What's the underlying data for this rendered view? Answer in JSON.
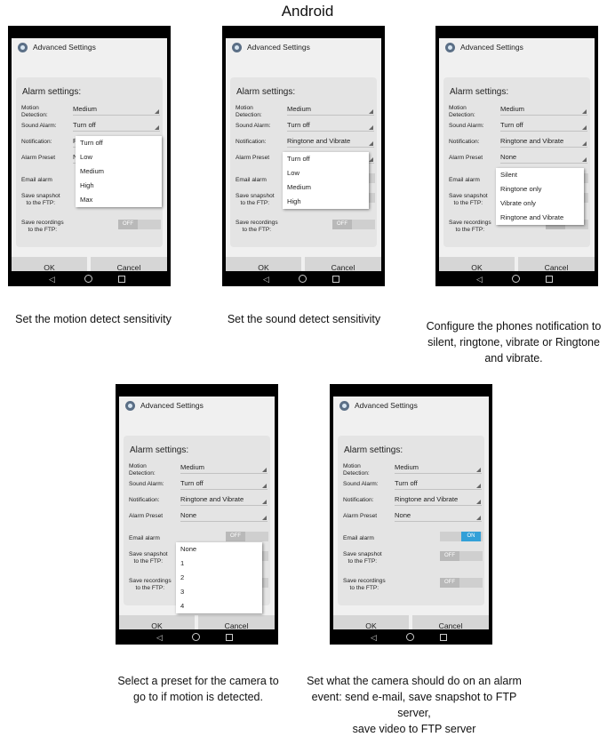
{
  "page_title": "Android",
  "screen": {
    "window_title": "Advanced Settings",
    "panel_title": "Alarm settings:",
    "labels": {
      "motion_line1": "Motion",
      "motion_line2": "Detection:",
      "sound": "Sound Alarm:",
      "notification": "Notification:",
      "preset": "Alarm Preset",
      "email": "Email alarm",
      "snapshot_line1": "Save snapshot",
      "snapshot_line2": "to the FTP:",
      "recordings_line1": "Save recordings",
      "recordings_line2": "to the FTP:"
    },
    "toggle_off_label": "OFF",
    "toggle_on_label": "ON",
    "ok_label": "OK",
    "cancel_label": "Cancel",
    "nav_back_glyph": "◁"
  },
  "phones": [
    {
      "values": {
        "motion": "Medium",
        "sound": "Turn off",
        "notification": "Ringtone and Vibrate",
        "preset": "None"
      },
      "dropdown": {
        "field": "motion",
        "options": [
          "Turn off",
          "Low",
          "Medium",
          "High",
          "Max"
        ]
      },
      "caption_lines": [
        "Set the motion detect sensitivity"
      ]
    },
    {
      "values": {
        "motion": "Medium",
        "sound": "Turn off",
        "notification": "Ringtone and Vibrate",
        "preset": "None"
      },
      "dropdown": {
        "field": "sound",
        "options": [
          "Turn off",
          "Low",
          "Medium",
          "High"
        ]
      },
      "caption_lines": [
        "Set the sound detect sensitivity"
      ]
    },
    {
      "values": {
        "motion": "Medium",
        "sound": "Turn off",
        "notification": "Ringtone and Vibrate",
        "preset": "None"
      },
      "dropdown": {
        "field": "notification",
        "options": [
          "Silent",
          "Ringtone only",
          "Vibrate only",
          "Ringtone and Vibrate"
        ]
      },
      "caption_lines": [
        "Configure the phones notification to",
        "silent, ringtone, vibrate or Ringtone",
        "and vibrate."
      ]
    },
    {
      "values": {
        "motion": "Medium",
        "sound": "Turn off",
        "notification": "Ringtone and Vibrate",
        "preset": "None"
      },
      "dropdown": {
        "field": "preset",
        "options": [
          "None",
          "1",
          "2",
          "3",
          "4"
        ]
      },
      "caption_lines": [
        "Select a preset for the camera to",
        "go to if motion is detected."
      ]
    },
    {
      "values": {
        "motion": "Medium",
        "sound": "Turn off",
        "notification": "Ringtone and Vibrate",
        "preset": "None"
      },
      "dropdown": null,
      "email_on": true,
      "caption_lines": [
        "Set what the camera should do on an alarm",
        "event: send e-mail, save snapshot to FTP server,",
        "save video to FTP server"
      ]
    }
  ],
  "colors": {
    "toggle_on": "#33a0d8",
    "panel": "#e4e4e4",
    "screen_bg": "#f0f0f0"
  }
}
